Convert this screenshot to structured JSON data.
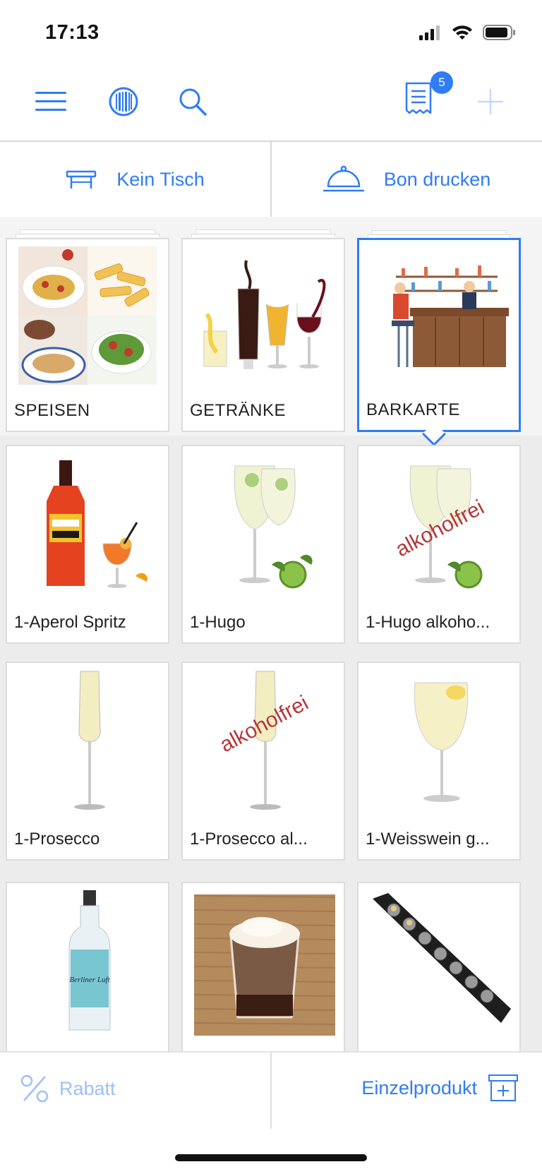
{
  "status_bar": {
    "time": "17:13"
  },
  "toolbar": {
    "receipt_badge": "5"
  },
  "actions": {
    "table_label": "Kein Tisch",
    "print_label": "Bon drucken"
  },
  "categories": [
    {
      "label": "SPEISEN",
      "selected": false
    },
    {
      "label": "GETRÄNKE",
      "selected": false
    },
    {
      "label": "BARKARTE",
      "selected": true
    }
  ],
  "products": [
    {
      "label": "1-Aperol Spritz"
    },
    {
      "label": "1-Hugo"
    },
    {
      "label": "1-Hugo alkoho...",
      "overlay": "alkoholfrei"
    },
    {
      "label": "1-Prosecco"
    },
    {
      "label": "1-Prosecco al...",
      "overlay": "alkoholfrei"
    },
    {
      "label": "1-Weisswein g..."
    },
    {
      "label": "",
      "bottle_text": "Berliner Luft"
    },
    {
      "label": ""
    },
    {
      "label": ""
    }
  ],
  "bottom": {
    "discount_label": "Rabatt",
    "single_product_label": "Einzelprodukt"
  },
  "colors": {
    "accent": "#2f7cf6",
    "accent_light": "#9dc0f7",
    "background": "#ececec"
  }
}
